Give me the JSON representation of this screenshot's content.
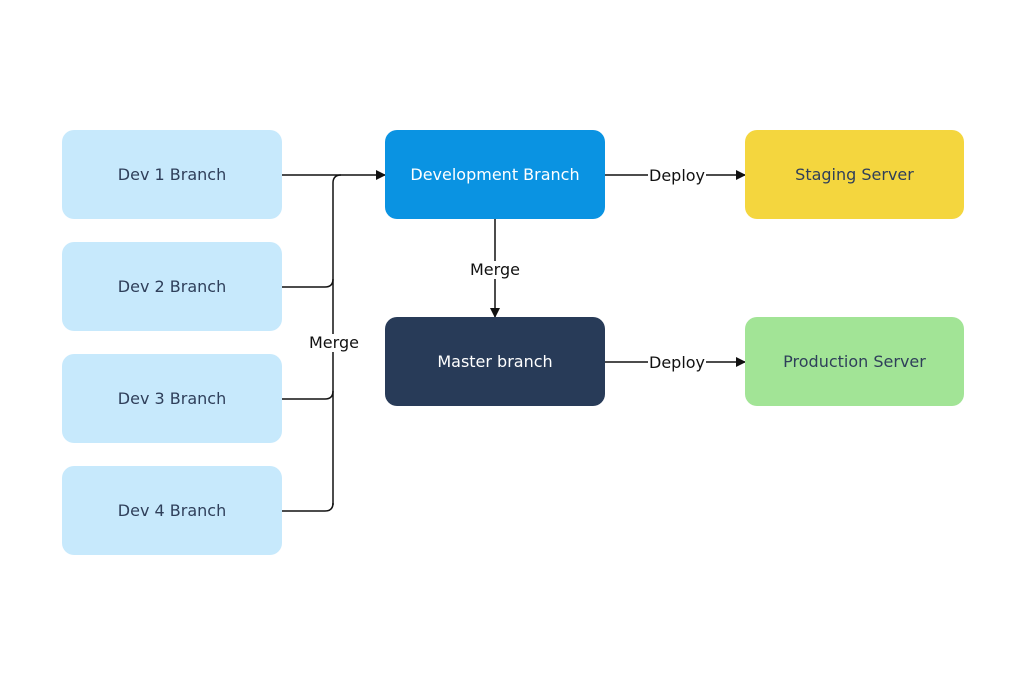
{
  "nodes": {
    "dev1": "Dev 1 Branch",
    "dev2": "Dev 2 Branch",
    "dev3": "Dev 3 Branch",
    "dev4": "Dev 4 Branch",
    "development": "Development Branch",
    "master": "Master branch",
    "staging": "Staging Server",
    "production": "Production Server"
  },
  "edges": {
    "merge_devs": "Merge",
    "merge_master": "Merge",
    "deploy_staging": "Deploy",
    "deploy_production": "Deploy"
  },
  "colors": {
    "dev": "#c7e9fc",
    "development": "#0a93e2",
    "master": "#283b58",
    "staging": "#f4d63e",
    "production": "#a2e496"
  }
}
